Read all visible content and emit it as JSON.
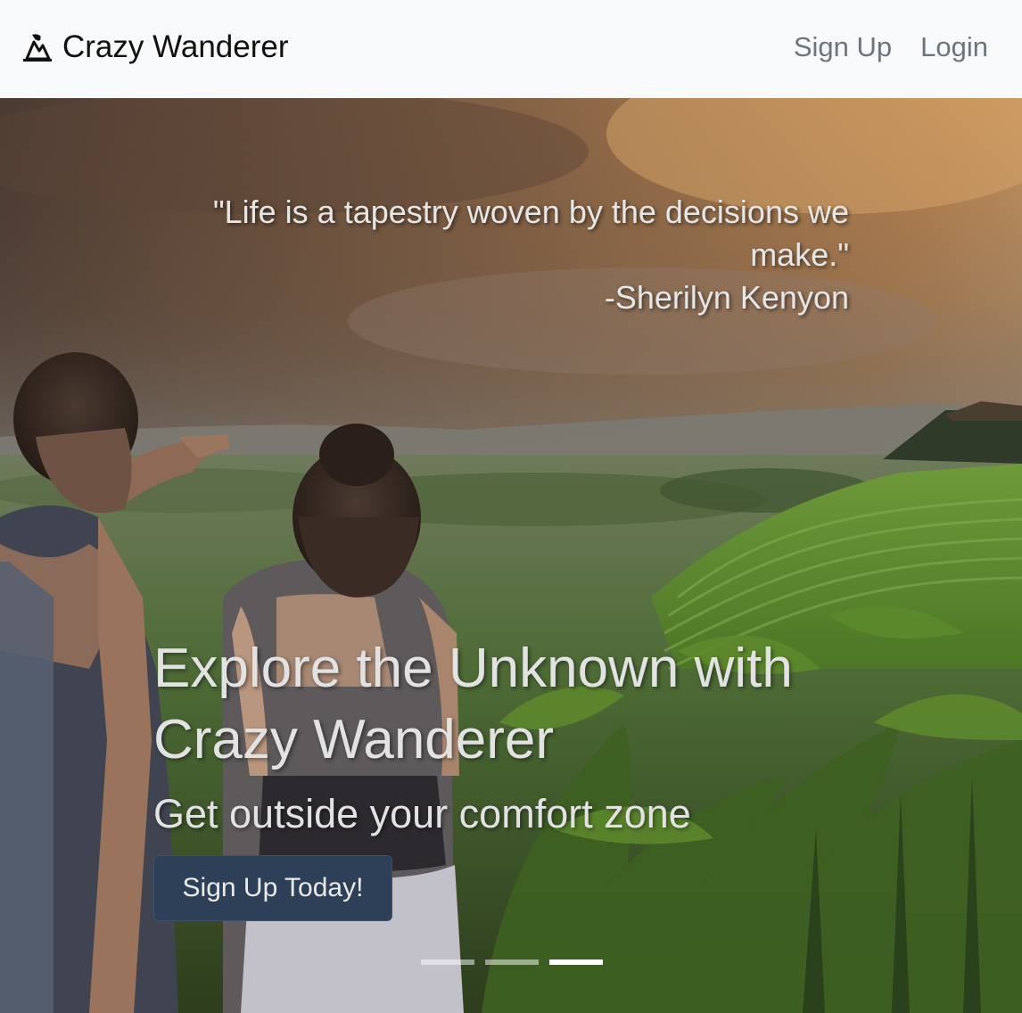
{
  "navbar": {
    "brand": "Crazy Wanderer",
    "brand_icon": "mountain-climber-icon",
    "links": [
      {
        "label": "Sign Up"
      },
      {
        "label": "Login"
      }
    ]
  },
  "hero": {
    "quote_text": "\"Life is a tapestry woven by the decisions we make.\"",
    "quote_author": "-Sherilyn Kenyon",
    "headline": "Explore the Unknown with Crazy Wanderer",
    "subheadline": "Get outside your comfort zone",
    "cta_label": "Sign Up Today!",
    "carousel": {
      "slide_count": 3,
      "active_index": 2
    }
  },
  "colors": {
    "navbar_bg": "#f8f9fa",
    "cta_bg": "#2e3f58",
    "text_light": "#e2e2e2",
    "nav_link": "#6c757d"
  }
}
